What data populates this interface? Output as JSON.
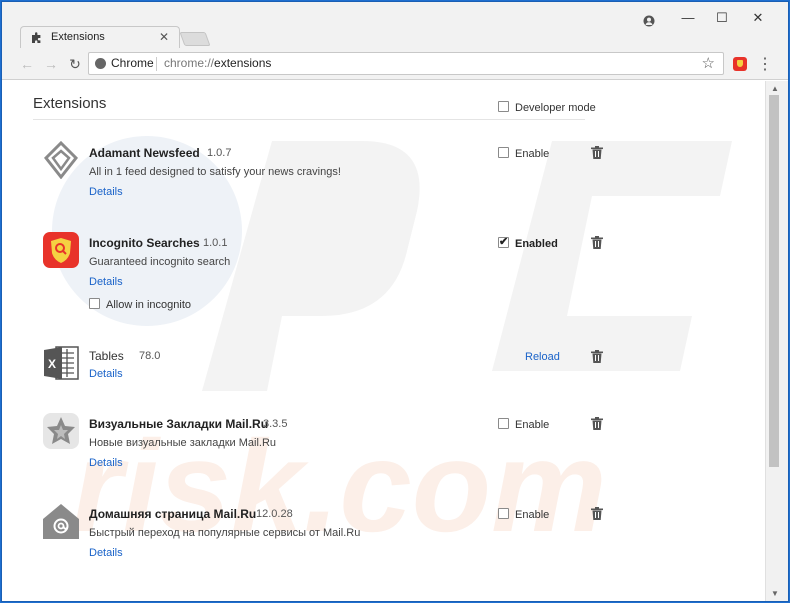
{
  "window": {
    "tab_title": "Extensions",
    "tab_close": "✕",
    "minimize": "—",
    "maximize": "☐",
    "close": "✕"
  },
  "toolbar": {
    "chip_label": "Chrome",
    "url_scheme": "chrome://",
    "url_path": "extensions"
  },
  "page": {
    "title": "Extensions",
    "developer_mode_label": "Developer mode"
  },
  "extensions": [
    {
      "name": "Adamant Newsfeed",
      "version": "1.0.7",
      "description": "All in 1 feed designed to satisfy your news cravings!",
      "details": "Details",
      "toggle_label": "Enable",
      "enabled": false,
      "icon": "diamond-icon"
    },
    {
      "name": "Incognito Searches",
      "version": "1.0.1",
      "description": "Guaranteed incognito search",
      "details": "Details",
      "toggle_label": "Enabled",
      "enabled": true,
      "extra_label": "Allow in incognito",
      "icon": "shield-search-icon"
    },
    {
      "name": "Tables",
      "version": "78.0",
      "details": "Details",
      "reload_label": "Reload",
      "icon": "excel-icon"
    },
    {
      "name": "Визуальные Закладки Mail.Ru",
      "version": "3.3.5",
      "description": "Новые визуальные закладки Mail.Ru",
      "details": "Details",
      "toggle_label": "Enable",
      "enabled": false,
      "icon": "star-icon"
    },
    {
      "name": "Домашняя страница Mail.Ru",
      "version": "12.0.28",
      "description": "Быстрый переход на популярные сервисы от Mail.Ru",
      "details": "Details",
      "toggle_label": "Enable",
      "enabled": false,
      "icon": "home-at-icon"
    }
  ],
  "colors": {
    "link": "#1a63c9",
    "frame": "#1e6fd0",
    "badge": "#e8332a"
  }
}
